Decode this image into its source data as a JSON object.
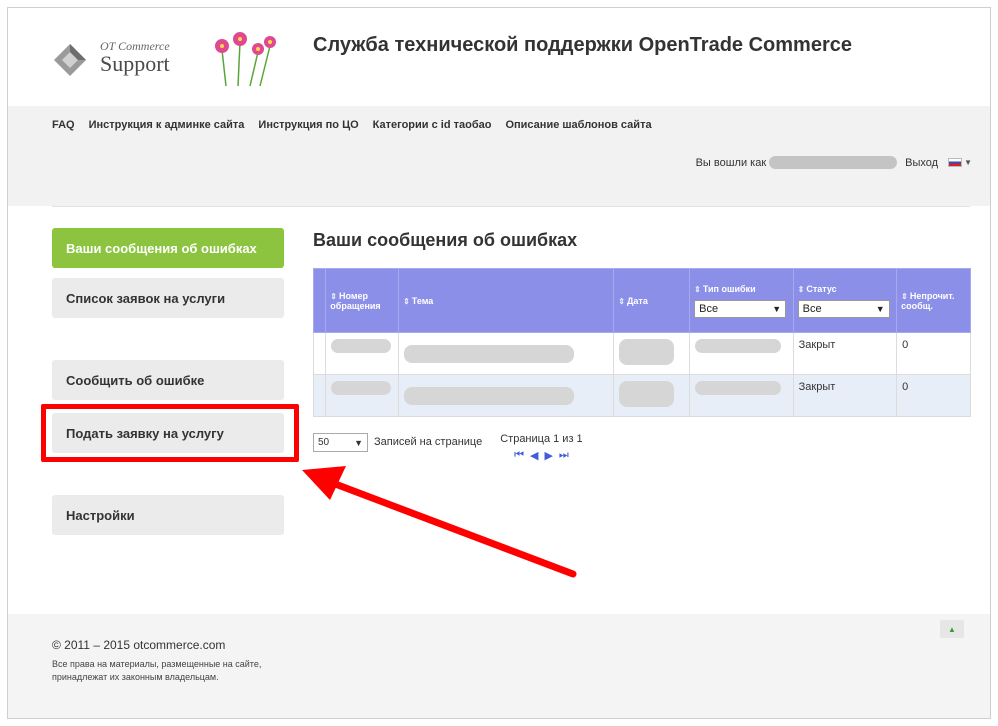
{
  "header": {
    "logo_small": "OT Commerce",
    "logo_big": "Support",
    "site_title": "Служба технической поддержки OpenTrade Commerce"
  },
  "nav": {
    "items": [
      "FAQ",
      "Инструкция к админке сайта",
      "Инструкция по ЦО",
      "Категории с id таобао",
      "Описание шаблонов сайта"
    ]
  },
  "user": {
    "logged_in_as": "Вы вошли как",
    "logout": "Выход"
  },
  "sidebar": {
    "items": [
      {
        "label": "Ваши сообщения об ошибках",
        "active": true
      },
      {
        "label": "Список заявок на услуги"
      },
      {
        "label": "Сообщить об ошибке"
      },
      {
        "label": "Подать заявку на услугу",
        "highlighted": true
      },
      {
        "label": "Настройки"
      }
    ]
  },
  "main": {
    "title": "Ваши сообщения об ошибках",
    "columns": [
      "Номер обращения",
      "Тема",
      "Дата",
      "Тип ошибки",
      "Статус",
      "Непрочит. сообщ."
    ],
    "filters": {
      "type": "Все",
      "status": "Все"
    },
    "rows": [
      {
        "status": "Закрыт",
        "unread": "0"
      },
      {
        "status": "Закрыт",
        "unread": "0"
      }
    ]
  },
  "pager": {
    "per_page": "50",
    "per_page_label": "Записей на странице",
    "page_info": "Страница 1 из 1"
  },
  "footer": {
    "copyright": "© 2011 – 2015 otcommerce.com",
    "rights": "Все права на материалы, размещенные на сайте, принадлежат их законным владельцам."
  },
  "colors": {
    "active_green": "#8cc43f",
    "table_header": "#8b8fe8",
    "annotation_red": "#ff0000"
  }
}
